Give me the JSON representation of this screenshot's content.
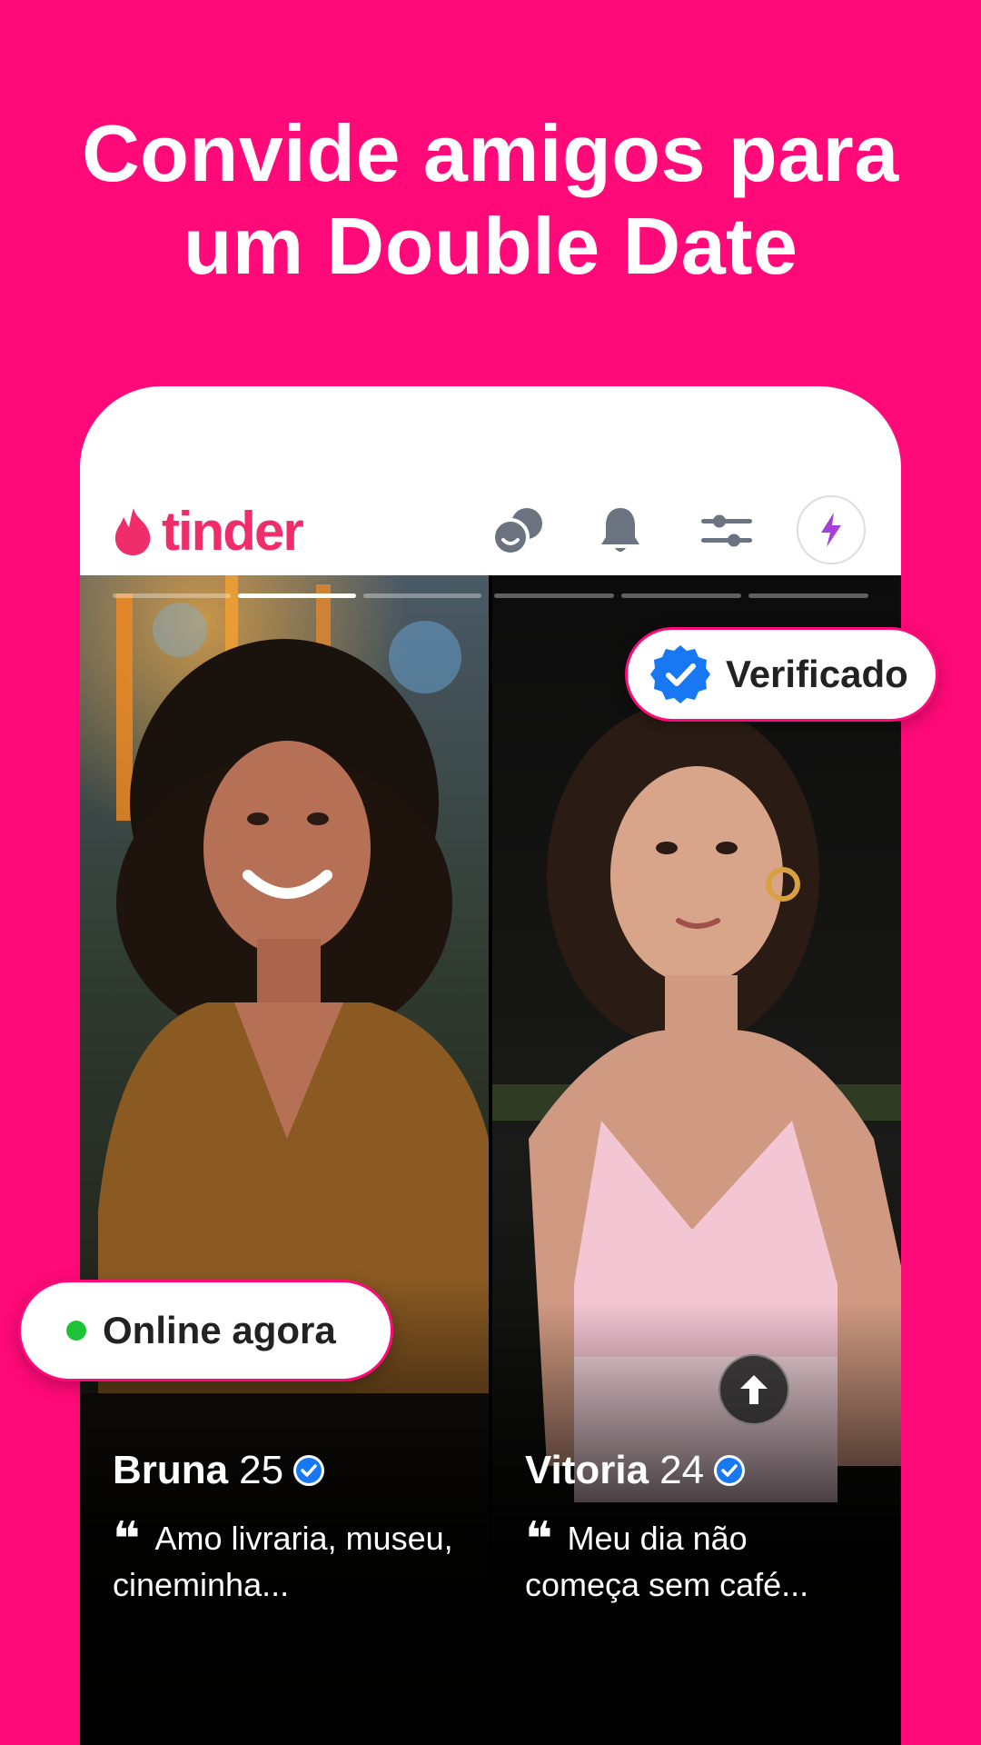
{
  "headline": {
    "line1": "Convide amigos para",
    "line2": "um Double Date"
  },
  "app": {
    "logo_text": "tinder",
    "icons": [
      "double-date-icon",
      "bell-icon",
      "filters-icon",
      "boost-icon"
    ],
    "colors": {
      "background": "#FF0A78",
      "brand": "#EE2D6A",
      "verified": "#1877F2",
      "online": "#1DC237"
    }
  },
  "photo_progress": {
    "left_segments": 3,
    "left_active_index": 1,
    "right_segments": 3
  },
  "badges": {
    "verified_label": "Verificado",
    "online_label": "Online agora"
  },
  "profiles": [
    {
      "name": "Bruna",
      "age": "25",
      "quote": "Amo livraria, museu, cineminha..."
    },
    {
      "name": "Vitoria",
      "age": "24",
      "quote": "Meu dia não começa sem café..."
    }
  ]
}
